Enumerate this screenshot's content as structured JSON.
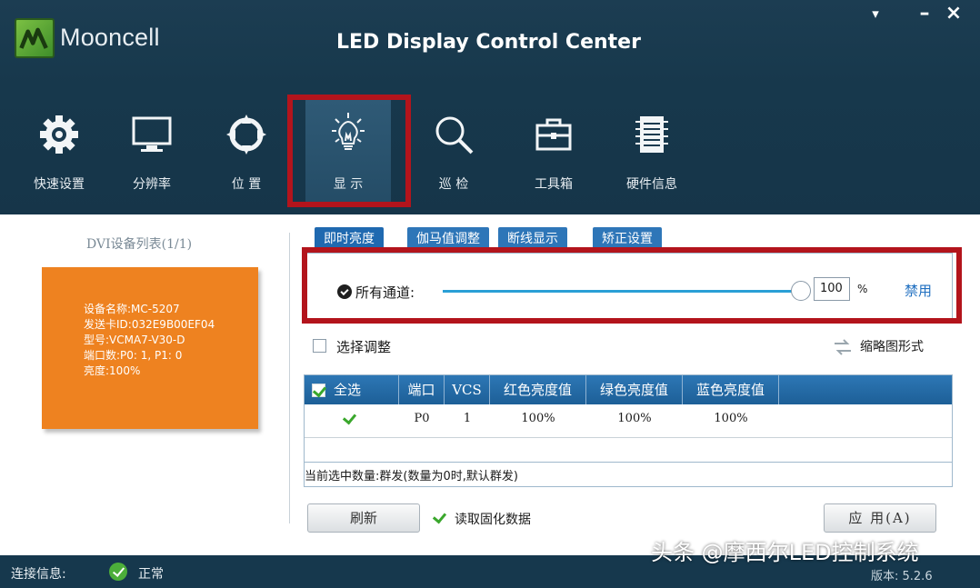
{
  "app": {
    "logo_text": "Mooncell",
    "title": "LED Display Control Center",
    "window_controls": [
      "▾",
      "–",
      "×"
    ]
  },
  "toolbar": {
    "items": [
      {
        "label": "快速设置",
        "icon": "gear-icon"
      },
      {
        "label": "分辨率",
        "icon": "monitor-icon"
      },
      {
        "label": "位 置",
        "icon": "crosshair-icon"
      },
      {
        "label": "显 示",
        "icon": "lightbulb-icon",
        "active": true
      },
      {
        "label": "巡 检",
        "icon": "magnifier-icon"
      },
      {
        "label": "工具箱",
        "icon": "toolbox-icon"
      },
      {
        "label": "硬件信息",
        "icon": "chip-icon"
      }
    ]
  },
  "device_list": {
    "title": "DVI设备列表(1/1)",
    "card_lines": [
      "设备名称:MC-5207",
      "发送卡ID:032E9B00EF04",
      "型号:VCMA7-V30-D",
      "端口数:P0: 1, P1: 0",
      "亮度:100%"
    ]
  },
  "tabs": [
    "即时亮度",
    "伽马值调整",
    "断线显示",
    "矫正设置"
  ],
  "brightness": {
    "channel_label": "所有通道:",
    "value": "100",
    "level_percent": 100,
    "unit": "%",
    "disable_label": "禁用"
  },
  "adjust": {
    "select_label": "选择调整",
    "thumbnail_label": "缩略图形式"
  },
  "table": {
    "select_all_label": "全选",
    "headers": [
      "端口",
      "VCS",
      "红色亮度值",
      "绿色亮度值",
      "蓝色亮度值"
    ],
    "rows": [
      {
        "checked": true,
        "port": "P0",
        "vcs": "1",
        "red": "100%",
        "green": "100%",
        "blue": "100%"
      }
    ],
    "count_label": "当前选中数量:群发(数量为0时,默认群发)"
  },
  "actions": {
    "refresh_label": "刷新",
    "read_label": "读取固化数据",
    "apply_label": "应 用(A)"
  },
  "status": {
    "conn_label": "连接信息:",
    "conn_status": "正常",
    "version_label": "版本: 5.2.6"
  },
  "watermark": "头条 @摩西尔LED控制系统",
  "colors": {
    "accent": "#2e76b8",
    "highlight_red": "#b3141c",
    "device_card": "#ee8220",
    "slider": "#2a9fd6"
  }
}
